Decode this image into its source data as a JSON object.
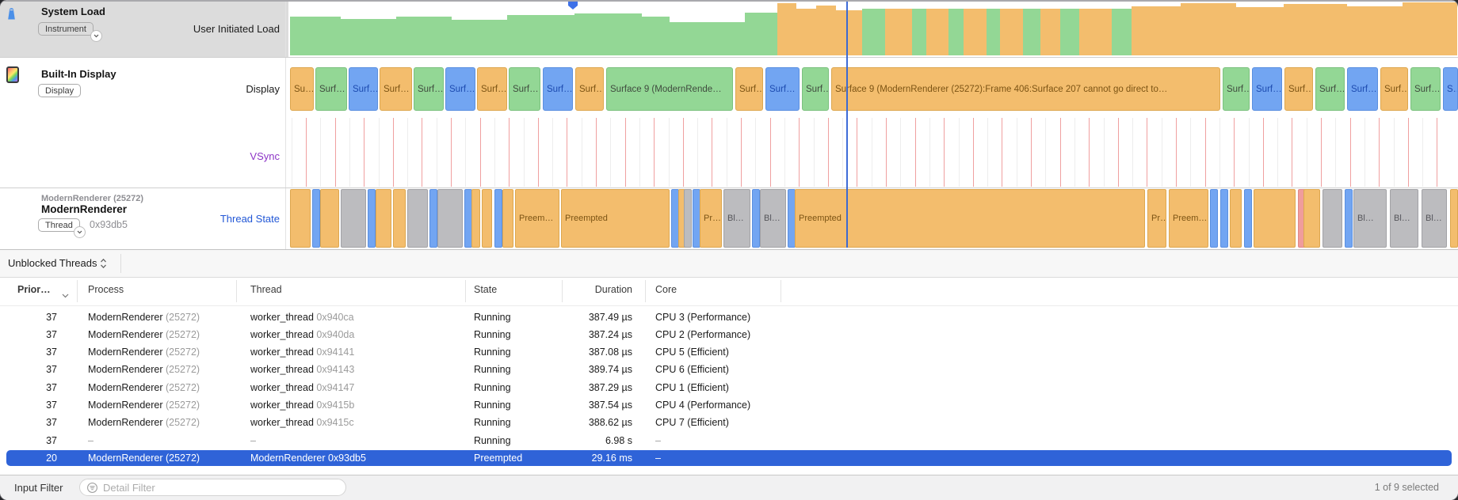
{
  "tracks": {
    "system_load": {
      "title": "System Load",
      "badge": "Instrument",
      "lane_label": "User Initiated Load"
    },
    "display": {
      "title": "Built-In Display",
      "badge": "Display",
      "lane1_label": "Display",
      "lane2_label": "VSync"
    },
    "renderer": {
      "subtitle": "ModernRenderer (25272)",
      "title": "ModernRenderer",
      "badge": "Thread",
      "thread_id": "0x93db5",
      "lane_label": "Thread State"
    }
  },
  "colors": {
    "orange": "#f3bd6d",
    "green": "#93d795",
    "blue": "#72a5f2",
    "gray": "#bcbcbf",
    "red": "#f09c9c",
    "orange_border": "#dda74f",
    "green_border": "#7bc17e",
    "blue_border": "#5a8fe0",
    "gray_border": "#a2a2a6",
    "red_border": "#e08888",
    "orange_text": "#7c5414",
    "green_text": "#3f4a3e",
    "blue_text": "#1d4bb0",
    "gray_text": "#55555a",
    "vsync_line": "#f0a0a0",
    "vsync_subline": "#ededed",
    "selection_blue": "#2f63d8",
    "vsync_label": "#8d35c6",
    "thread_state_label": "#2257d6"
  },
  "playhead": {
    "line_x": 1069,
    "marker_x": 723
  },
  "chart_data": [
    {
      "id": "system_load",
      "type": "area",
      "title": "User Initiated Load",
      "x_range": [
        366,
        1840
      ],
      "lane_y": [
        2,
        70
      ],
      "green_steps": [
        [
          366,
          430,
          21
        ],
        [
          430,
          500,
          24
        ],
        [
          500,
          570,
          21
        ],
        [
          570,
          640,
          25
        ],
        [
          640,
          725,
          19
        ],
        [
          725,
          810,
          17
        ],
        [
          810,
          845,
          21
        ],
        [
          845,
          940,
          28
        ],
        [
          940,
          981,
          16
        ]
      ],
      "orange_steps": [
        [
          981,
          1005,
          4
        ],
        [
          1005,
          1030,
          11
        ],
        [
          1030,
          1055,
          7
        ],
        [
          1055,
          1088,
          13
        ]
      ],
      "alt_bars": [
        [
          1088,
          29,
          "g"
        ],
        [
          1117,
          34,
          "o"
        ],
        [
          1151,
          18,
          "g"
        ],
        [
          1169,
          28,
          "o"
        ],
        [
          1197,
          19,
          "g"
        ],
        [
          1216,
          29,
          "o"
        ],
        [
          1245,
          17,
          "g"
        ],
        [
          1262,
          29,
          "o"
        ],
        [
          1291,
          22,
          "g"
        ],
        [
          1313,
          25,
          "o"
        ],
        [
          1338,
          24,
          "g"
        ],
        [
          1362,
          41,
          "o"
        ],
        [
          1403,
          25,
          "g"
        ]
      ],
      "alt_bar_top": 11,
      "orange_tail": [
        [
          1428,
          1490,
          8
        ],
        [
          1490,
          1560,
          4
        ],
        [
          1560,
          1620,
          9
        ],
        [
          1620,
          1700,
          5
        ],
        [
          1700,
          1770,
          8
        ],
        [
          1770,
          1839,
          3
        ]
      ]
    },
    {
      "id": "display_surfaces",
      "type": "timeline",
      "blocks": [
        [
          366,
          30,
          "o",
          "Su…"
        ],
        [
          398,
          40,
          "g",
          "Surf…"
        ],
        [
          440,
          37,
          "b",
          "Surf…"
        ],
        [
          479,
          41,
          "o",
          "Surf…"
        ],
        [
          522,
          38,
          "g",
          "Surf…"
        ],
        [
          562,
          38,
          "b",
          "Surf…"
        ],
        [
          602,
          38,
          "o",
          "Surf…"
        ],
        [
          642,
          40,
          "g",
          "Surf…"
        ],
        [
          685,
          38,
          "b",
          "Surf…"
        ],
        [
          726,
          36,
          "o",
          "Surf…"
        ],
        [
          765,
          160,
          "g",
          "Surface 9 (ModernRende…"
        ],
        [
          928,
          35,
          "o",
          "Surf…"
        ],
        [
          966,
          43,
          "b",
          "Surf…"
        ],
        [
          1012,
          34,
          "g",
          "Surf…"
        ],
        [
          1049,
          491,
          "o",
          "Surface 9 (ModernRenderer (25272):Frame 406:Surface 207 cannot go direct to…"
        ],
        [
          1543,
          34,
          "g",
          "Surf…"
        ],
        [
          1580,
          38,
          "b",
          "Surf…"
        ],
        [
          1621,
          36,
          "o",
          "Surf…"
        ],
        [
          1660,
          37,
          "g",
          "Surf…"
        ],
        [
          1700,
          39,
          "b",
          "Surf…"
        ],
        [
          1742,
          35,
          "o",
          "Surf…"
        ],
        [
          1780,
          38,
          "g",
          "Surf…"
        ],
        [
          1821,
          19,
          "b",
          "S…"
        ]
      ]
    },
    {
      "id": "vsync",
      "type": "event-lines",
      "start": 386,
      "end": 1840,
      "spacing": 36.6
    },
    {
      "id": "thread_state",
      "type": "timeline",
      "blocks": [
        [
          366,
          26,
          "o",
          ""
        ],
        [
          394,
          8,
          "b",
          ""
        ],
        [
          404,
          24,
          "o",
          ""
        ],
        [
          430,
          32,
          "x",
          ""
        ],
        [
          464,
          8,
          "b",
          ""
        ],
        [
          474,
          20,
          "o",
          ""
        ],
        [
          496,
          16,
          "o",
          ""
        ],
        [
          514,
          26,
          "x",
          ""
        ],
        [
          542,
          8,
          "b",
          ""
        ],
        [
          552,
          32,
          "x",
          ""
        ],
        [
          586,
          7,
          "b",
          ""
        ],
        [
          595,
          11,
          "o",
          ""
        ],
        [
          608,
          13,
          "o",
          ""
        ],
        [
          624,
          8,
          "b",
          ""
        ],
        [
          634,
          14,
          "o",
          ""
        ],
        [
          650,
          56,
          "o",
          "Preem…"
        ],
        [
          708,
          137,
          "o",
          "Preempted"
        ],
        [
          847,
          7,
          "b",
          ""
        ],
        [
          856,
          6,
          "o",
          ""
        ],
        [
          863,
          9,
          "x",
          ""
        ],
        [
          874,
          7,
          "b",
          ""
        ],
        [
          883,
          28,
          "o",
          "Pr…"
        ],
        [
          913,
          34,
          "x",
          "Bl…"
        ],
        [
          949,
          8,
          "b",
          ""
        ],
        [
          959,
          33,
          "x",
          "Bl…"
        ],
        [
          994,
          7,
          "b",
          ""
        ],
        [
          1003,
          442,
          "o",
          "Preempted"
        ],
        [
          1448,
          24,
          "o",
          "Pr…"
        ],
        [
          1475,
          50,
          "o",
          "Preem…"
        ],
        [
          1527,
          9,
          "b",
          ""
        ],
        [
          1540,
          9,
          "b",
          ""
        ],
        [
          1552,
          15,
          "o",
          ""
        ],
        [
          1570,
          9,
          "b",
          ""
        ],
        [
          1582,
          53,
          "o",
          ""
        ],
        [
          1638,
          4,
          "r",
          ""
        ],
        [
          1645,
          21,
          "o",
          ""
        ],
        [
          1669,
          25,
          "x",
          ""
        ],
        [
          1697,
          8,
          "b",
          ""
        ],
        [
          1708,
          42,
          "x",
          "Bl…"
        ],
        [
          1754,
          36,
          "x",
          "Bl…"
        ],
        [
          1794,
          32,
          "x",
          "Bl…"
        ],
        [
          1830,
          10,
          "o",
          ""
        ]
      ]
    }
  ],
  "detail_bar": {
    "scope_label": "Unblocked Threads"
  },
  "table": {
    "columns": [
      {
        "label": "Prior…"
      },
      {
        "label": "Process"
      },
      {
        "label": "Thread"
      },
      {
        "label": "State"
      },
      {
        "label": "Duration"
      },
      {
        "label": "Core"
      }
    ],
    "rows": [
      {
        "priority": "37",
        "process": "ModernRenderer",
        "process_pid": "(25272)",
        "thread": "worker_thread",
        "thread_id": "0x940ca",
        "state": "Running",
        "duration": "387.49 µs",
        "core": "CPU 3 (Performance)"
      },
      {
        "priority": "37",
        "process": "ModernRenderer",
        "process_pid": "(25272)",
        "thread": "worker_thread",
        "thread_id": "0x940da",
        "state": "Running",
        "duration": "387.24 µs",
        "core": "CPU 2 (Performance)"
      },
      {
        "priority": "37",
        "process": "ModernRenderer",
        "process_pid": "(25272)",
        "thread": "worker_thread",
        "thread_id": "0x94141",
        "state": "Running",
        "duration": "387.08 µs",
        "core": "CPU 5 (Efficient)"
      },
      {
        "priority": "37",
        "process": "ModernRenderer",
        "process_pid": "(25272)",
        "thread": "worker_thread",
        "thread_id": "0x94143",
        "state": "Running",
        "duration": "389.74 µs",
        "core": "CPU 6 (Efficient)"
      },
      {
        "priority": "37",
        "process": "ModernRenderer",
        "process_pid": "(25272)",
        "thread": "worker_thread",
        "thread_id": "0x94147",
        "state": "Running",
        "duration": "387.29 µs",
        "core": "CPU 1 (Efficient)"
      },
      {
        "priority": "37",
        "process": "ModernRenderer",
        "process_pid": "(25272)",
        "thread": "worker_thread",
        "thread_id": "0x9415b",
        "state": "Running",
        "duration": "387.54 µs",
        "core": "CPU 4 (Performance)"
      },
      {
        "priority": "37",
        "process": "ModernRenderer",
        "process_pid": "(25272)",
        "thread": "worker_thread",
        "thread_id": "0x9415c",
        "state": "Running",
        "duration": "388.62 µs",
        "core": "CPU 7 (Efficient)"
      },
      {
        "priority": "37",
        "process": "–",
        "process_pid": "",
        "thread": "–",
        "thread_id": "",
        "state": "Running",
        "duration": "6.98 s",
        "core": "–"
      },
      {
        "priority": "20",
        "process": "ModernRenderer",
        "process_pid": "(25272)",
        "thread": "ModernRenderer",
        "thread_id": "0x93db5",
        "state": "Preempted",
        "duration": "29.16 ms",
        "core": "–",
        "selected": true
      }
    ],
    "selected_index": 8
  },
  "status_bar": {
    "input_filter_label": "Input Filter",
    "placeholder": "Detail Filter",
    "selection": "1 of 9 selected"
  }
}
